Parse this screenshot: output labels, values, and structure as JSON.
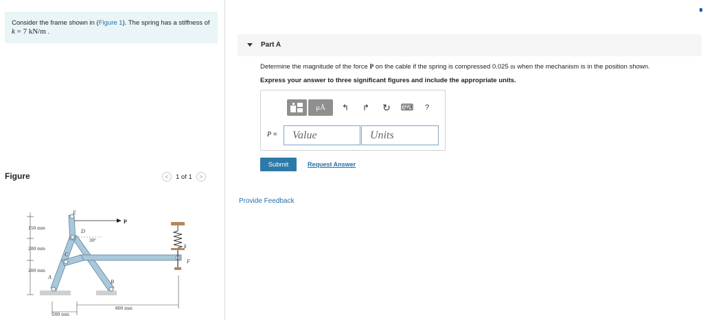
{
  "problem": {
    "text_before": "Consider the frame shown in (",
    "figure_link": "Figure 1",
    "text_after": "). The spring has a stiffness of ",
    "k_symbol": "k",
    "equals": " = 7 ",
    "k_unit": "kN/m",
    "end": " ."
  },
  "figure_panel": {
    "title": "Figure",
    "pager": "1 of 1",
    "prev": "<",
    "next": ">"
  },
  "diagram": {
    "labels": {
      "E": "E",
      "D": "D",
      "C": "C",
      "A": "A",
      "B": "B",
      "P": "P",
      "k": "k",
      "F": "F",
      "angle": "30°"
    },
    "dims": {
      "d1": "150 mm",
      "d2": "200 mm",
      "d3": "200 mm",
      "d4": "200 mm",
      "d5": "800 mm"
    }
  },
  "part": {
    "label": "Part A",
    "question_before": "Determine the magnitude of the force ",
    "question_P": "P",
    "question_mid": " on the cable if the spring is compressed 0.025 ",
    "question_unit": "m",
    "question_after": " when the mechanism is in the position shown.",
    "instructions": "Express your answer to three significant figures and include the appropriate units."
  },
  "answer": {
    "toolbar": {
      "mu": "μÅ",
      "undo": "↰",
      "redo": "↱",
      "reset": "↻",
      "keyboard": "⌨",
      "help": "?"
    },
    "var_label": "P",
    "eq": " =",
    "value_placeholder": "Value",
    "units_placeholder": "Units"
  },
  "buttons": {
    "submit": "Submit",
    "request_answer": "Request Answer",
    "feedback": "Provide Feedback"
  },
  "colors": {
    "link": "#1f6fae",
    "submit_bg": "#2c7aa8",
    "problem_bg": "#e9f5f6",
    "frame_fill": "#a9c8dc"
  }
}
